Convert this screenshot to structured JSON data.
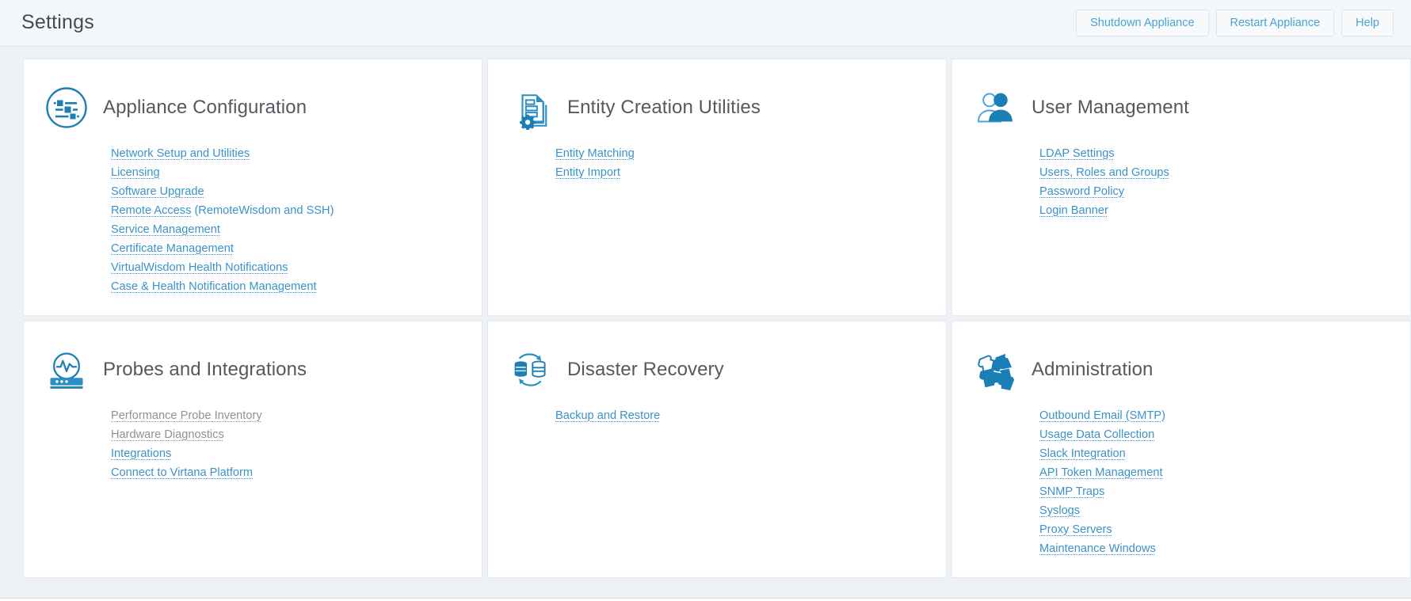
{
  "header": {
    "title": "Settings",
    "buttons": [
      {
        "label": "Shutdown Appliance",
        "name": "shutdown-appliance-button"
      },
      {
        "label": "Restart Appliance",
        "name": "restart-appliance-button"
      },
      {
        "label": "Help",
        "name": "help-button"
      }
    ]
  },
  "colors": {
    "link": "#3a93c9",
    "link_disabled": "#8d9298",
    "title": "#55595e",
    "icon": "#1b7fb5",
    "page_bg": "#eef2f7",
    "header_bg": "#f4f7fa",
    "card_bg": "#ffffff",
    "card_border": "#e4e9ef",
    "button_text": "#4aa3d8"
  },
  "cards": [
    {
      "title": "Appliance Configuration",
      "icon": "sliders-circle-icon",
      "links": [
        {
          "label": "Network Setup and Utilities",
          "disabled": false
        },
        {
          "label": "Licensing",
          "disabled": false
        },
        {
          "label": "Software Upgrade",
          "disabled": false
        },
        {
          "label": "Remote Access",
          "suffix": " (RemoteWisdom and SSH)",
          "disabled": false
        },
        {
          "label": "Service Management",
          "disabled": false
        },
        {
          "label": "Certificate Management",
          "disabled": false
        },
        {
          "label": "VirtualWisdom Health Notifications",
          "disabled": false
        },
        {
          "label": "Case & Health Notification Management",
          "disabled": false
        }
      ]
    },
    {
      "title": "Entity Creation Utilities",
      "icon": "documents-gear-icon",
      "links": [
        {
          "label": "Entity Matching",
          "disabled": false
        },
        {
          "label": "Entity Import",
          "disabled": false
        }
      ]
    },
    {
      "title": "User Management",
      "icon": "users-icon",
      "links": [
        {
          "label": "LDAP Settings",
          "disabled": false
        },
        {
          "label": "Users, Roles and Groups",
          "disabled": false
        },
        {
          "label": "Password Policy",
          "disabled": false
        },
        {
          "label": "Login Banner",
          "disabled": false
        }
      ]
    },
    {
      "title": "Probes and Integrations",
      "icon": "probe-monitor-icon",
      "links": [
        {
          "label": "Performance Probe Inventory",
          "disabled": true
        },
        {
          "label": "Hardware Diagnostics",
          "disabled": true
        },
        {
          "label": "Integrations",
          "disabled": false
        },
        {
          "label": "Connect to Virtana Platform",
          "disabled": false
        }
      ]
    },
    {
      "title": "Disaster Recovery",
      "icon": "database-sync-icon",
      "links": [
        {
          "label": "Backup and Restore",
          "disabled": false
        }
      ]
    },
    {
      "title": "Administration",
      "icon": "puzzle-pieces-icon",
      "links": [
        {
          "label": "Outbound Email (SMTP)",
          "disabled": false
        },
        {
          "label": "Usage Data Collection",
          "disabled": false
        },
        {
          "label": "Slack Integration",
          "disabled": false
        },
        {
          "label": "API Token Management",
          "disabled": false
        },
        {
          "label": "SNMP Traps",
          "disabled": false
        },
        {
          "label": "Syslogs",
          "disabled": false
        },
        {
          "label": "Proxy Servers",
          "disabled": false
        },
        {
          "label": "Maintenance Windows",
          "disabled": false
        }
      ]
    }
  ]
}
